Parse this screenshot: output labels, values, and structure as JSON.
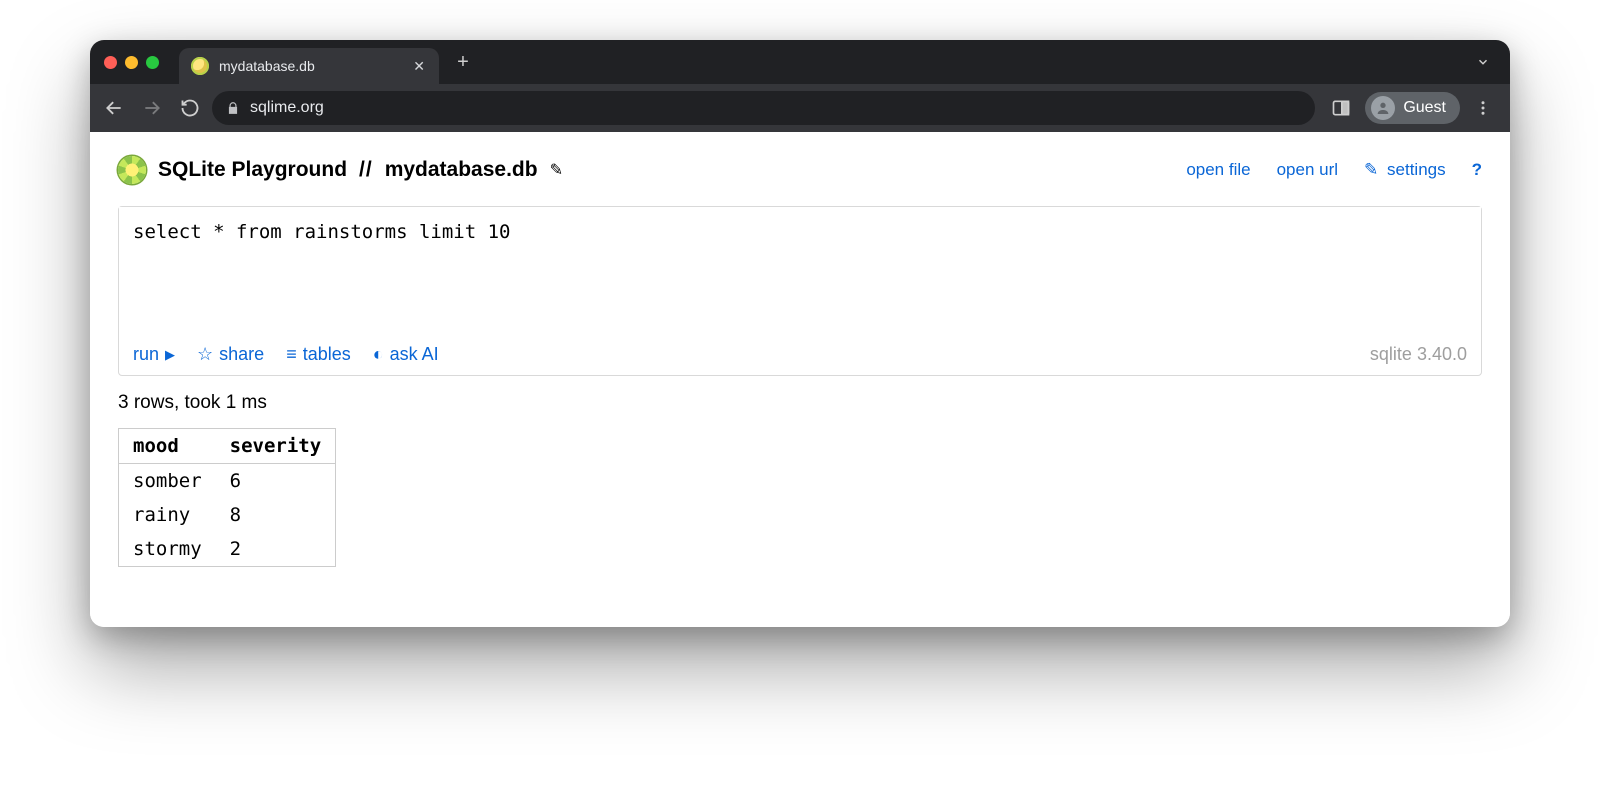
{
  "browser": {
    "tab_title": "mydatabase.db",
    "omnibox_url": "sqlime.org",
    "guest_label": "Guest"
  },
  "header": {
    "app_title": "SQLite Playground",
    "separator": "//",
    "db_name": "mydatabase.db",
    "links": {
      "open_file": "open file",
      "open_url": "open url",
      "settings": "settings",
      "help": "?"
    },
    "settings_icon": "✎"
  },
  "editor": {
    "query": "select * from rainstorms limit 10",
    "footer": {
      "run": "run",
      "share": "share",
      "tables": "tables",
      "ask_ai": "ask AI",
      "run_glyph": "▶",
      "share_glyph": "☆",
      "tables_glyph": "≡",
      "ask_glyph": "◐"
    },
    "version": "sqlite 3.40.0"
  },
  "result": {
    "status": "3 rows, took 1 ms",
    "columns": [
      "mood",
      "severity"
    ],
    "rows": [
      {
        "mood": "somber",
        "severity": "6"
      },
      {
        "mood": "rainy",
        "severity": "8"
      },
      {
        "mood": "stormy",
        "severity": "2"
      }
    ]
  }
}
